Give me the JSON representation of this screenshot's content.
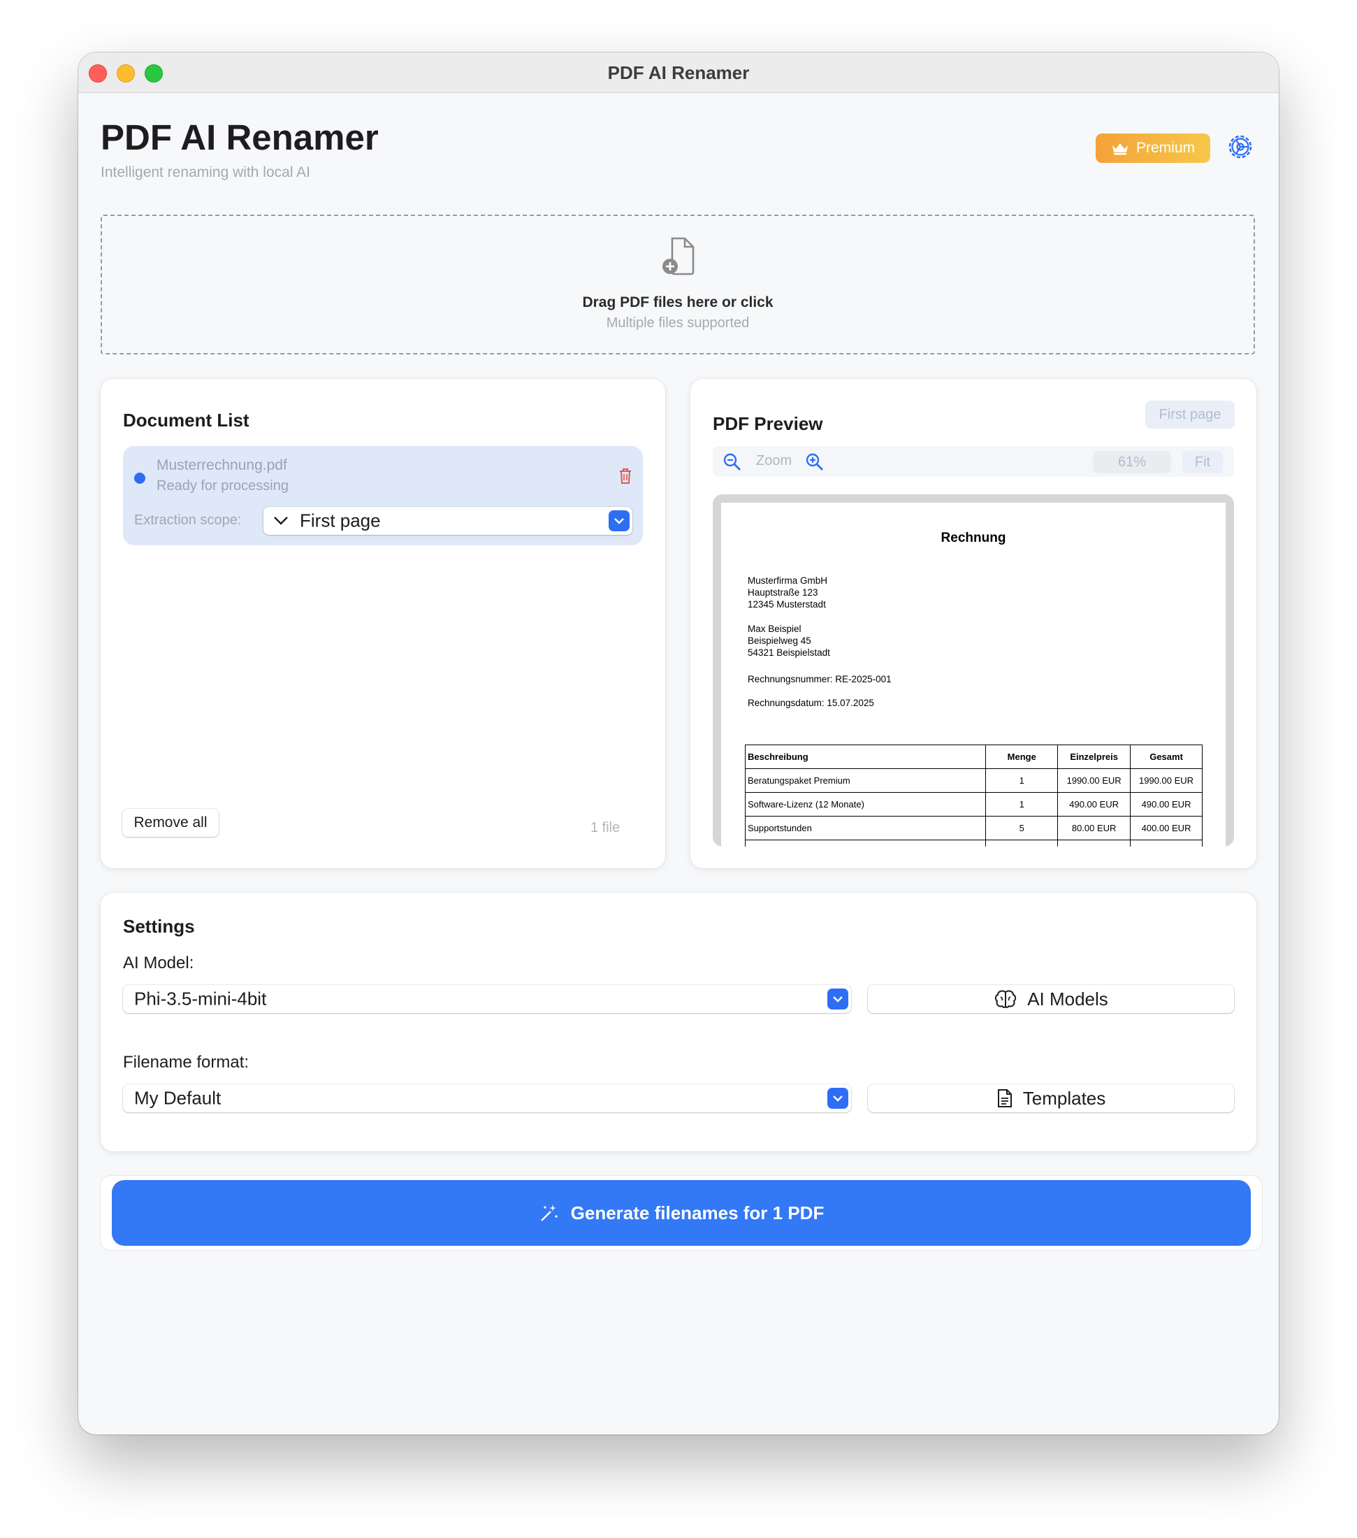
{
  "window": {
    "title": "PDF AI Renamer"
  },
  "header": {
    "title": "PDF AI Renamer",
    "subtitle": "Intelligent renaming with local AI",
    "premium_label": "Premium"
  },
  "dropzone": {
    "main_text": "Drag PDF files here or click",
    "sub_text": "Multiple files supported"
  },
  "document_list": {
    "title": "Document List",
    "items": [
      {
        "name": "Musterrechnung.pdf",
        "status": "Ready for processing",
        "scope_label": "Extraction scope:",
        "scope_value": "First page"
      }
    ],
    "remove_all_label": "Remove all",
    "file_count": "1 file"
  },
  "preview": {
    "title": "PDF Preview",
    "page_button": "First page",
    "zoom_label": "Zoom",
    "zoom_level": "61%",
    "fit_label": "Fit",
    "document": {
      "heading": "Rechnung",
      "sender": [
        "Musterfirma GmbH",
        "Hauptstraße 123",
        "12345 Musterstadt"
      ],
      "recipient": [
        "Max Beispiel",
        "Beispielweg 45",
        "54321 Beispielstadt"
      ],
      "invoice_number": "Rechnungsnummer: RE-2025-001",
      "invoice_date": "Rechnungsdatum: 15.07.2025",
      "table_headers": [
        "Beschreibung",
        "Menge",
        "Einzelpreis",
        "Gesamt"
      ],
      "table_rows": [
        [
          "Beratungspaket Premium",
          "1",
          "1990.00 EUR",
          "1990.00 EUR"
        ],
        [
          "Software-Lizenz (12 Monate)",
          "1",
          "490.00 EUR",
          "490.00 EUR"
        ],
        [
          "Supportstunden",
          "5",
          "80.00 EUR",
          "400.00 EUR"
        ]
      ]
    }
  },
  "settings": {
    "title": "Settings",
    "ai_model_label": "AI Model:",
    "ai_model_value": "Phi-3.5-mini-4bit",
    "ai_models_button": "AI Models",
    "filename_format_label": "Filename format:",
    "filename_format_value": "My Default",
    "templates_button": "Templates"
  },
  "generate_button": "Generate filenames for 1 PDF",
  "colors": {
    "accent": "#3378f5",
    "premium_start": "#f4a23a",
    "premium_end": "#f6c84a",
    "selected_item_bg": "#dee8f8",
    "delete_red": "#e5534b"
  },
  "icons": [
    "crown-icon",
    "gear-icon",
    "doc-plus-icon",
    "trash-icon",
    "chevron-down-icon",
    "zoom-out-icon",
    "zoom-in-icon",
    "brain-icon",
    "document-icon",
    "magic-wand-icon"
  ]
}
